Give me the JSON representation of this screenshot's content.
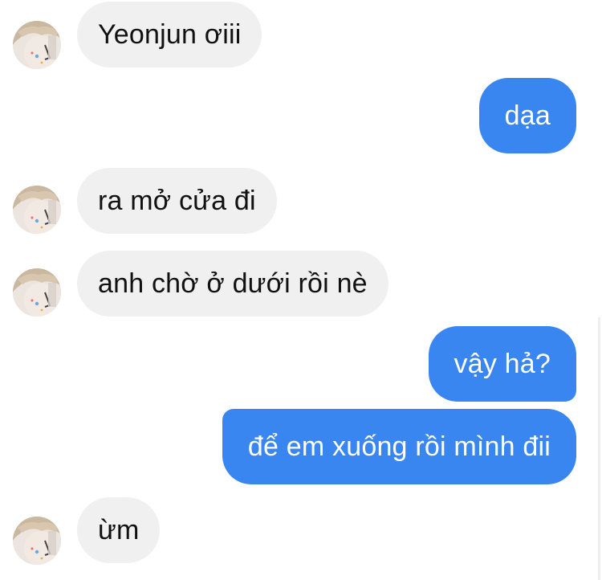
{
  "conversation": {
    "messages": [
      {
        "sender": "contact",
        "text": "Yeonjun ơiii"
      },
      {
        "sender": "me",
        "text": "dạa"
      },
      {
        "sender": "contact",
        "text": "ra mở cửa đi"
      },
      {
        "sender": "contact",
        "text": "anh chờ ở dưới rồi nè"
      },
      {
        "sender": "me",
        "text": "vậy hả?"
      },
      {
        "sender": "me",
        "text": "để em xuống rồi mình đii"
      },
      {
        "sender": "contact",
        "text": "ừm"
      }
    ]
  },
  "colors": {
    "incoming_bubble": "#f0f0f0",
    "outgoing_bubble": "#3a86f0",
    "incoming_text": "#111111",
    "outgoing_text": "#ffffff"
  },
  "icons": {
    "avatar": "contact-avatar-photo"
  }
}
